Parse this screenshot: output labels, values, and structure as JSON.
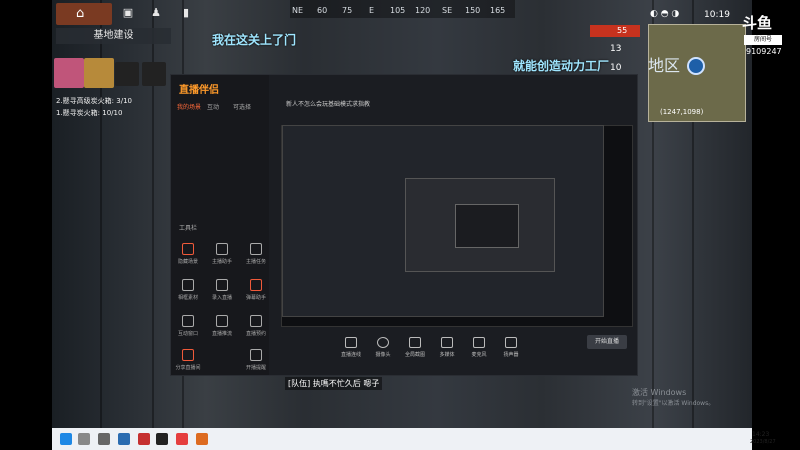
{
  "game": {
    "base_title": "基地建设",
    "compass": [
      "NE",
      "60",
      "75",
      "E",
      "105",
      "120",
      "SE",
      "150",
      "165"
    ],
    "chat_line_1": "我在这关上了门",
    "chat_line_2": "就能创造动力工厂",
    "region": "地区",
    "coords": "(1247,1098)",
    "time": "10:19",
    "hp": "55",
    "ammo_1": "13",
    "ammo_2": "10",
    "quests": [
      "2.懸寻高级炭火箱: 3/10",
      "1.懸寻炭火箱: 10/10"
    ],
    "team_chat": "[队伍] 执嗎不忙久后 嗯子",
    "activate_windows": "激活 Windows",
    "activate_hint": "转到\"设置\"以激活 Windows。"
  },
  "streamer_app": {
    "logo": "直播伴侣",
    "tabs": [
      "我的场景",
      "互动",
      "可选择"
    ],
    "document_title": "新人不怎么会玩基础模式求指教",
    "tools_title": "工具栏",
    "tools": [
      "隐藏场景",
      "主播助手",
      "主播任务",
      "相框素材",
      "录入直播",
      "弹幕助手",
      "互动窗口",
      "直播推流",
      "直播预约",
      "分享直播间",
      "开播提醒"
    ],
    "bottom_buttons": [
      "直播连线",
      "摄像头",
      "全局截图",
      "多媒体",
      "麦克风",
      "扬声器"
    ],
    "start_live": "开始直播"
  },
  "douyu": {
    "brand": "斗鱼",
    "room_label": "房间号",
    "room_id": "9109247"
  },
  "taskbar": {
    "time": "14:23",
    "date": "2023/8/27"
  },
  "colors": {
    "accent": "#ff9a2a",
    "hp_red": "#c7321e",
    "chat_cyan": "#9fe6ff"
  }
}
